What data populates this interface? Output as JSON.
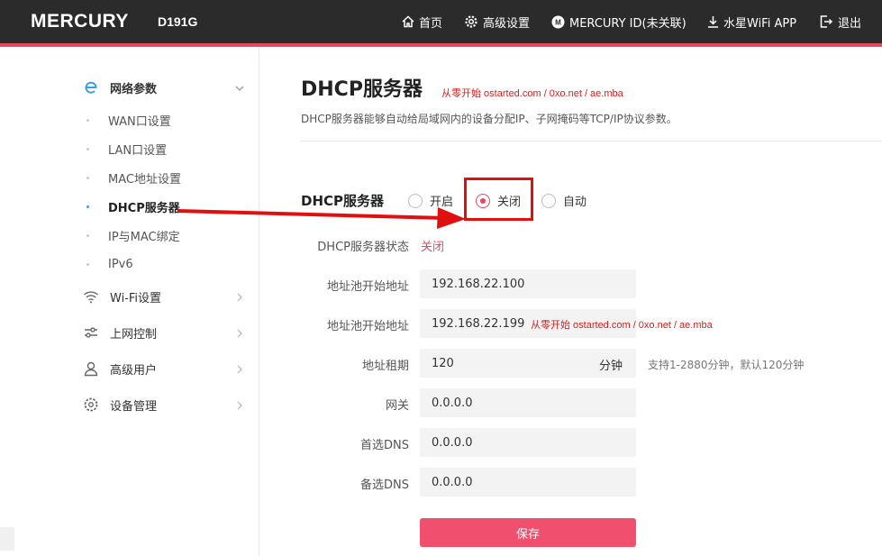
{
  "header": {
    "brand": "MERCURY",
    "model": "D191G",
    "nav": [
      {
        "label": "首页",
        "icon": "home-icon"
      },
      {
        "label": "高级设置",
        "icon": "gear-icon"
      },
      {
        "label": "MERCURY ID(未关联)",
        "icon": "mercury-id-icon"
      },
      {
        "label": "水星WiFi APP",
        "icon": "download-icon"
      },
      {
        "label": "退出",
        "icon": "logout-icon"
      }
    ],
    "accent_color": "#e8475f"
  },
  "sidebar": {
    "groups": [
      {
        "label": "网络参数",
        "icon": "network-e-icon",
        "expanded": true,
        "items": [
          "WAN口设置",
          "LAN口设置",
          "MAC地址设置",
          "DHCP服务器",
          "IP与MAC绑定",
          "IPv6"
        ],
        "active_item": "DHCP服务器"
      },
      {
        "label": "Wi-Fi设置",
        "icon": "wifi-icon"
      },
      {
        "label": "上网控制",
        "icon": "sliders-icon"
      },
      {
        "label": "高级用户",
        "icon": "user-icon"
      },
      {
        "label": "设备管理",
        "icon": "device-gear-icon"
      }
    ]
  },
  "main": {
    "title": "DHCP服务器",
    "description": "DHCP服务器能够自动给局域网内的设备分配IP、子网掩码等TCP/IP协议参数。",
    "dhcp_label": "DHCP服务器",
    "options": [
      "开启",
      "关闭",
      "自动"
    ],
    "selected_option": "关闭",
    "status_label": "DHCP服务器状态",
    "status_value": "关闭",
    "fields": [
      {
        "label": "地址池开始地址",
        "value": "192.168.22.100"
      },
      {
        "label": "地址池开始地址",
        "value": "192.168.22.199"
      },
      {
        "label": "地址租期",
        "value": "120",
        "unit": "分钟",
        "hint": "支持1-2880分钟，默认120分钟"
      },
      {
        "label": "网关",
        "value": "0.0.0.0"
      },
      {
        "label": "首选DNS",
        "value": "0.0.0.0"
      },
      {
        "label": "备选DNS",
        "value": "0.0.0.0"
      }
    ],
    "save_label": "保存"
  },
  "watermark": "从零开始 ostarted.com / 0xo.net / ae.mba",
  "annotation_color": "#e01010"
}
